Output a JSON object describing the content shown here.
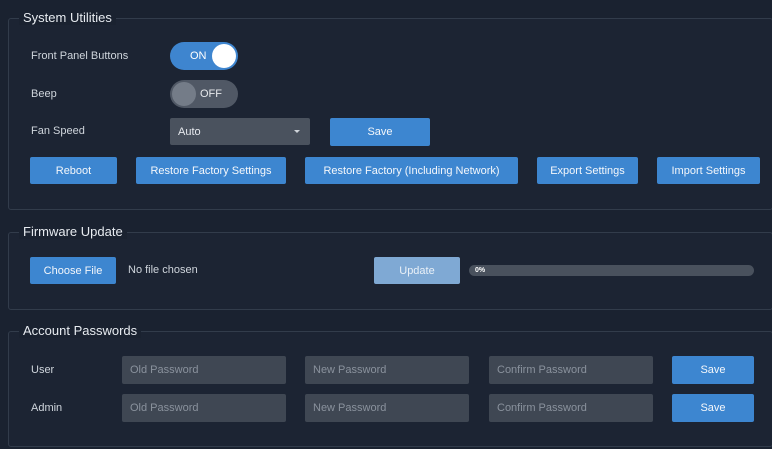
{
  "system_utilities": {
    "title": "System Utilities",
    "front_panel_label": "Front Panel Buttons",
    "front_panel_state": "ON",
    "beep_label": "Beep",
    "beep_state": "OFF",
    "fan_speed_label": "Fan Speed",
    "fan_speed_value": "Auto",
    "save_label": "Save",
    "buttons": {
      "reboot": "Reboot",
      "restore_factory": "Restore Factory Settings",
      "restore_factory_network": "Restore Factory (Including Network)",
      "export": "Export Settings",
      "import": "Import Settings"
    }
  },
  "firmware_update": {
    "title": "Firmware Update",
    "choose_file_label": "Choose File",
    "file_status": "No file chosen",
    "update_label": "Update",
    "progress_text": "0%",
    "progress_value": 0
  },
  "account_passwords": {
    "title": "Account Passwords",
    "rows": [
      {
        "label": "User",
        "old_placeholder": "Old Password",
        "new_placeholder": "New Password",
        "confirm_placeholder": "Confirm Password",
        "save_label": "Save"
      },
      {
        "label": "Admin",
        "old_placeholder": "Old Password",
        "new_placeholder": "New Password",
        "confirm_placeholder": "Confirm Password",
        "save_label": "Save"
      }
    ]
  },
  "colors": {
    "background": "#1a2230",
    "accent": "#3d86d0",
    "input": "#3f4753"
  }
}
